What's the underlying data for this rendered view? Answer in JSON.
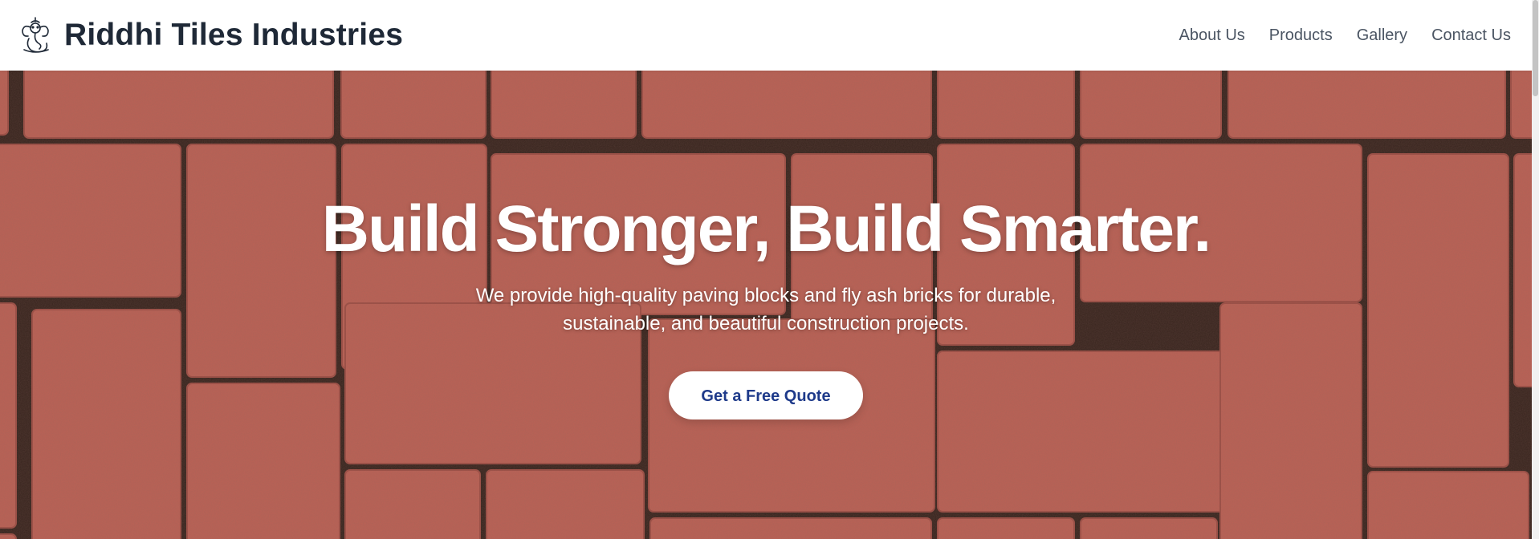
{
  "brand": {
    "logo_icon": "ganesha-logo-icon",
    "name": "Riddhi Tiles Industries"
  },
  "nav": {
    "items": [
      {
        "label": "About Us"
      },
      {
        "label": "Products"
      },
      {
        "label": "Gallery"
      },
      {
        "label": "Contact Us"
      }
    ]
  },
  "hero": {
    "title": "Build Stronger, Build Smarter.",
    "subtitle": "We provide high-quality paving blocks and fly ash bricks for durable, sustainable, and beautiful construction projects.",
    "cta_label": "Get a Free Quote",
    "background": "red-brick-paver-pattern"
  },
  "colors": {
    "brand_text": "#1f2937",
    "nav_text": "#4b5563",
    "cta_text": "#1e3a8a",
    "brick": "#c2665a",
    "grout": "#3a2620"
  }
}
